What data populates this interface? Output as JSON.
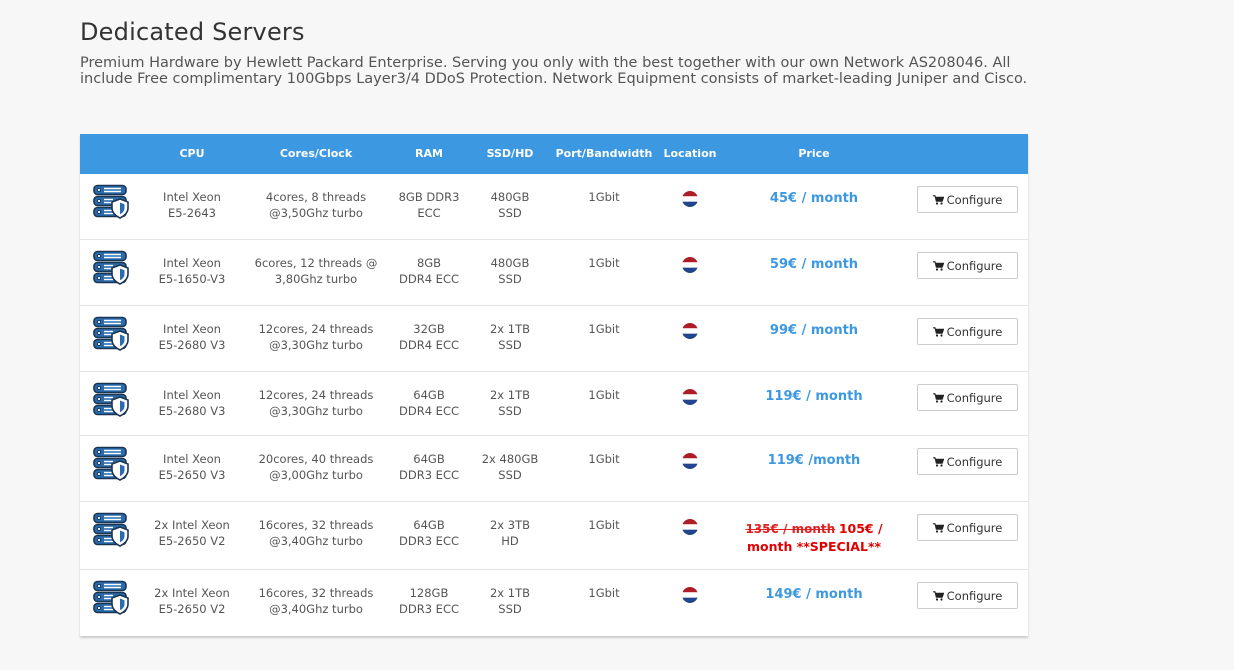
{
  "page": {
    "title": "Dedicated Servers",
    "description": "Premium Hardware by Hewlett Packard Enterprise. Serving you only with the best together with our own Network AS208046. All include Free complimentary 100Gbps Layer3/4 DDoS Protection. Network Equipment consists of market-leading Juniper and Cisco."
  },
  "table": {
    "headers": {
      "cpu": "CPU",
      "cores": "Cores/Clock",
      "ram": "RAM",
      "ssd": "SSD/HD",
      "port": "Port/Bandwidth",
      "location": "Location",
      "price": "Price"
    },
    "configure_label": "Configure",
    "row_icon": "server-shield-icon",
    "location_icon": "netherlands-flag-icon",
    "colors": {
      "header_bg": "#3d98e2",
      "price": "#3d98e2",
      "special": "#e00000"
    },
    "rows": [
      {
        "cpu_1": "Intel Xeon",
        "cpu_2": "E5-2643",
        "cores_1": "4cores, 8 threads",
        "cores_2": "@3,50Ghz turbo",
        "ram_1": "8GB DDR3",
        "ram_2": "ECC",
        "ssd_1": "480GB",
        "ssd_2": "SSD",
        "port": "1Gbit",
        "price": "45€ / month"
      },
      {
        "cpu_1": "Intel Xeon",
        "cpu_2": "E5-1650-V3",
        "cores_1": "6cores, 12 threads @",
        "cores_2": "3,80Ghz turbo",
        "ram_1": "8GB",
        "ram_2": "DDR4 ECC",
        "ssd_1": "480GB",
        "ssd_2": "SSD",
        "port": "1Gbit",
        "price": "59€ / month"
      },
      {
        "cpu_1": "Intel Xeon",
        "cpu_2": "E5-2680 V3",
        "cores_1": "12cores, 24 threads",
        "cores_2": "@3,30Ghz turbo",
        "ram_1": "32GB",
        "ram_2": "DDR4 ECC",
        "ssd_1": "2x 1TB",
        "ssd_2": "SSD",
        "port": "1Gbit",
        "price": "99€ / month"
      },
      {
        "cpu_1": "Intel Xeon",
        "cpu_2": "E5-2680 V3",
        "cores_1": "12cores, 24 threads",
        "cores_2": "@3,30Ghz turbo",
        "ram_1": "64GB",
        "ram_2": "DDR4 ECC",
        "ssd_1": "2x 1TB",
        "ssd_2": "SSD",
        "port": "1Gbit",
        "price": "119€ / month"
      },
      {
        "cpu_1": "Intel Xeon",
        "cpu_2": "E5-2650 V3",
        "cores_1": "20cores, 40 threads",
        "cores_2": "@3,00Ghz turbo",
        "ram_1": "64GB",
        "ram_2": "DDR3 ECC",
        "ssd_1": "2x 480GB",
        "ssd_2": "SSD",
        "port": "1Gbit",
        "price": "119€ /month"
      },
      {
        "cpu_1": "2x Intel Xeon",
        "cpu_2": "E5-2650 V2",
        "cores_1": "16cores, 32 threads",
        "cores_2": "@3,40Ghz turbo",
        "ram_1": "64GB",
        "ram_2": "DDR3 ECC",
        "ssd_1": "2x 3TB",
        "ssd_2": "HD",
        "port": "1Gbit",
        "old_price": "135€ / month",
        "special_price": "105€ / month **SPECIAL**"
      },
      {
        "cpu_1": "2x Intel Xeon",
        "cpu_2": "E5-2650 V2",
        "cores_1": "16cores, 32 threads",
        "cores_2": "@3,40Ghz turbo",
        "ram_1": "128GB",
        "ram_2": "DDR3 ECC",
        "ssd_1": "2x 1TB",
        "ssd_2": "SSD",
        "port": "1Gbit",
        "price": "149€ / month"
      }
    ]
  }
}
